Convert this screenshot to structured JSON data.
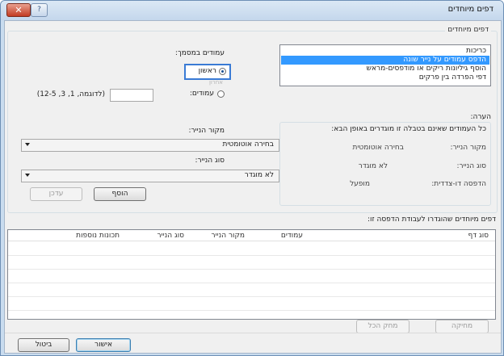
{
  "window": {
    "title": "דפים מיוחדים"
  },
  "group": {
    "label": "דפים מיוחדים"
  },
  "special_pages": {
    "items": [
      {
        "label": "כריכות",
        "selected": false
      },
      {
        "label": "הדפס עמודים על נייר שונה",
        "selected": true
      },
      {
        "label": "הוסף גיליונות ריקים או מודפסים-מראש",
        "selected": false
      },
      {
        "label": "דפי הפרדה בין פרקים",
        "selected": false
      }
    ]
  },
  "pages_in_doc": {
    "label": "עמודים במסמך:",
    "first_label": "ראשון",
    "last_label": "אחרון",
    "pages_label": "עמודים:",
    "pages_value": "",
    "example": "(לדוגמה, 1, 3, 12-5)"
  },
  "paper_source": {
    "label": "מקור הנייר:",
    "value": "בחירה אוטומטית"
  },
  "paper_type": {
    "label": "סוג הנייר:",
    "value": "לא מוגדר"
  },
  "buttons": {
    "add": "הוסף",
    "update": "עדכן",
    "delete": "מחיקה",
    "delete_all": "מחק הכל",
    "ok": "אישור",
    "cancel": "ביטול"
  },
  "note": {
    "title": "הערה:",
    "text": "כל העמודים שאינם בטבלה זו מוגדרים באופן הבא:",
    "rows": [
      {
        "key": "מקור הנייר:",
        "value": "בחירה אוטומטית"
      },
      {
        "key": "סוג הנייר:",
        "value": "לא מוגדר"
      },
      {
        "key": "הדפסה דו-צדדית:",
        "value": "מופעל"
      }
    ]
  },
  "table": {
    "caption": "דפים מיוחדים שהוגדרו לעבודת הדפסה זו:",
    "columns": [
      "סוג דף",
      "עמודים",
      "מקור הנייר",
      "סוג הנייר",
      "תכונות נוספות"
    ]
  }
}
